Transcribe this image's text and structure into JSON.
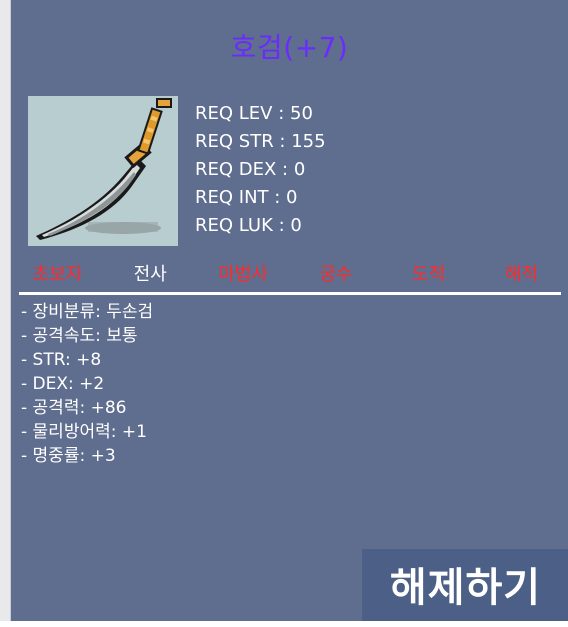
{
  "item": {
    "name": "호검(+7)",
    "icon": "sword-icon"
  },
  "requirements": [
    {
      "label": "REQ LEV : 50"
    },
    {
      "label": "REQ STR : 155"
    },
    {
      "label": "REQ DEX : 0"
    },
    {
      "label": "REQ INT : 0"
    },
    {
      "label": "REQ LUK : 0"
    }
  ],
  "jobs": [
    {
      "label": "초보자",
      "allowed": false
    },
    {
      "label": "전사",
      "allowed": true
    },
    {
      "label": "마법사",
      "allowed": false
    },
    {
      "label": "궁수",
      "allowed": false
    },
    {
      "label": "도적",
      "allowed": false
    },
    {
      "label": "해적",
      "allowed": false
    }
  ],
  "stats": [
    "- 장비분류: 두손검",
    "- 공격속도: 보통",
    "- STR: +8",
    "- DEX: +2",
    "- 공격력: +86",
    "- 물리방어력: +1",
    "- 명중률: +3"
  ],
  "actions": {
    "release_label": "해제하기"
  },
  "colors": {
    "title": "#6a2bff",
    "panel": "#5f6d8e",
    "job_disallowed": "#ff2a2a",
    "job_allowed": "#ffffff",
    "button": "#4b5f87"
  }
}
